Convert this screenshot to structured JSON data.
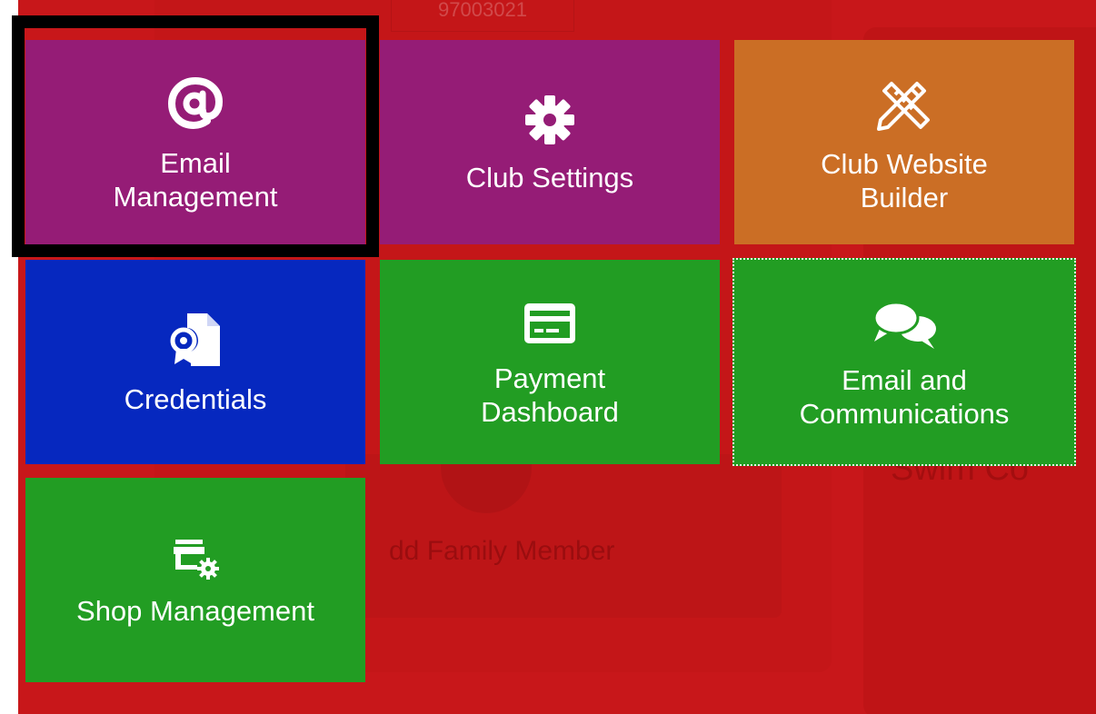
{
  "background": {
    "number_text": "97003021",
    "add_family_text": "dd Family Member",
    "swim_text": "Swim Co"
  },
  "tiles": [
    {
      "label": "Email\nManagement",
      "icon": "at-sign-icon",
      "color": "#951c76"
    },
    {
      "label": "Club Settings",
      "icon": "gear-icon",
      "color": "#951c76"
    },
    {
      "label": "Club Website\nBuilder",
      "icon": "pencil-ruler-icon",
      "color": "#cb6e25"
    },
    {
      "label": "Credentials",
      "icon": "certificate-document-icon",
      "color": "#0628bf"
    },
    {
      "label": "Payment\nDashboard",
      "icon": "credit-card-icon",
      "color": "#229d23"
    },
    {
      "label": "Email and\nCommunications",
      "icon": "chat-bubbles-icon",
      "color": "#229d23"
    },
    {
      "label": "Shop Management",
      "icon": "store-settings-icon",
      "color": "#229d23"
    }
  ],
  "colors": {
    "page_background": "#c8171a",
    "focus_outline": "#000000"
  }
}
